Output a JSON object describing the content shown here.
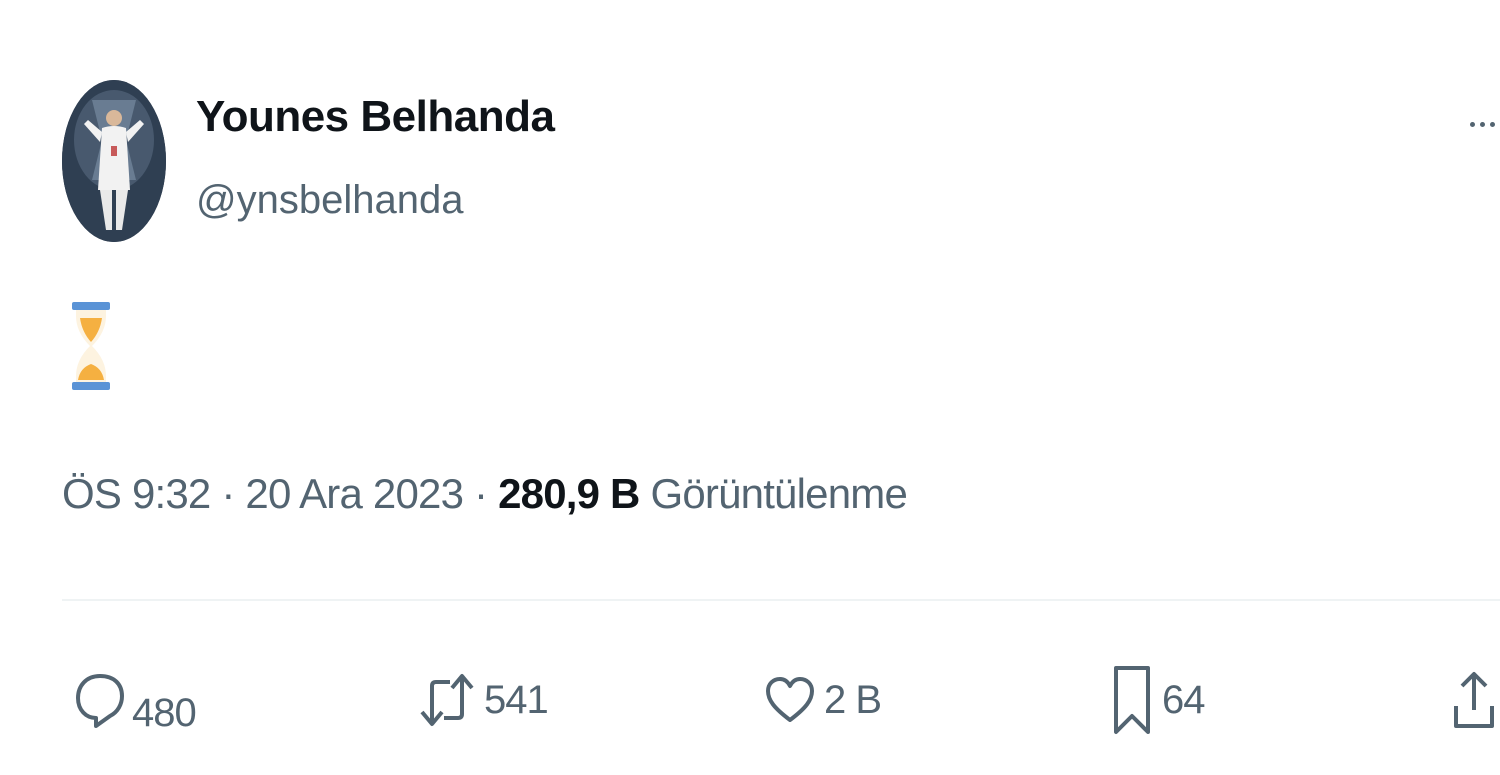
{
  "author": {
    "display_name": "Younes Belhanda",
    "handle": "@ynsbelhanda",
    "avatar_icon": "profile-photo"
  },
  "tweet": {
    "content_emoji": "hourglass-emoji",
    "timestamp": "ÖS 9:32 · 20 Ara 2023 · ",
    "views_count": "280,9 B",
    "views_label": " Görüntülenme"
  },
  "actions": {
    "reply": {
      "icon": "reply-icon",
      "count": "480"
    },
    "retweet": {
      "icon": "retweet-icon",
      "count": "541"
    },
    "like": {
      "icon": "heart-icon",
      "count": "2 B"
    },
    "bookmark": {
      "icon": "bookmark-icon",
      "count": "64"
    },
    "share": {
      "icon": "share-icon"
    }
  },
  "colors": {
    "primary_text": "#0f1419",
    "secondary_text": "#536471",
    "divider": "#eff3f4",
    "hourglass_frame": "#5a93d6",
    "hourglass_sand": "#f5b041"
  }
}
